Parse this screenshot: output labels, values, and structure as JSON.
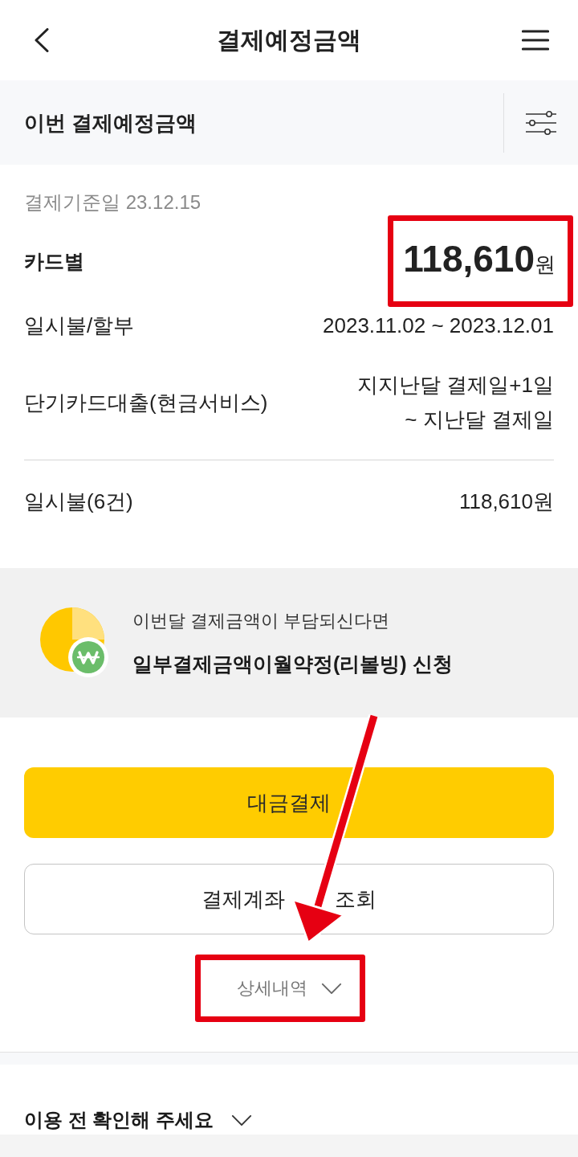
{
  "header": {
    "title": "결제예정금액"
  },
  "section_bar": {
    "title": "이번 결제예정금액"
  },
  "summary": {
    "base_date": "결제기준일 23.12.15",
    "label": "카드별",
    "amount": "118,610",
    "currency": "원",
    "highlighted": true
  },
  "periods": [
    {
      "label": "일시불/할부",
      "lines": [
        "2023.11.02 ~ 2023.12.01"
      ]
    },
    {
      "label": "단기카드대출(현금서비스)",
      "lines": [
        "지지난달 결제일+1일",
        "~ 지난달 결제일"
      ]
    }
  ],
  "totals": [
    {
      "label": "일시불(6건)",
      "value": "118,610원"
    }
  ],
  "revolving_banner": {
    "subtitle": "이번달 결제금액이 부담되신다면",
    "title": "일부결제금액이월약정(리볼빙) 신청"
  },
  "buttons": [
    {
      "kind": "primary",
      "label_parts": [
        "대금결제"
      ]
    },
    {
      "kind": "outline",
      "label_parts": [
        "결제계좌",
        "조회"
      ]
    }
  ],
  "details_toggle": {
    "label": "상세내역",
    "expanded": false,
    "highlighted": true
  },
  "notice": {
    "label": "이용 전 확인해 주세요",
    "expanded": false
  },
  "pointer_arrow": true
}
